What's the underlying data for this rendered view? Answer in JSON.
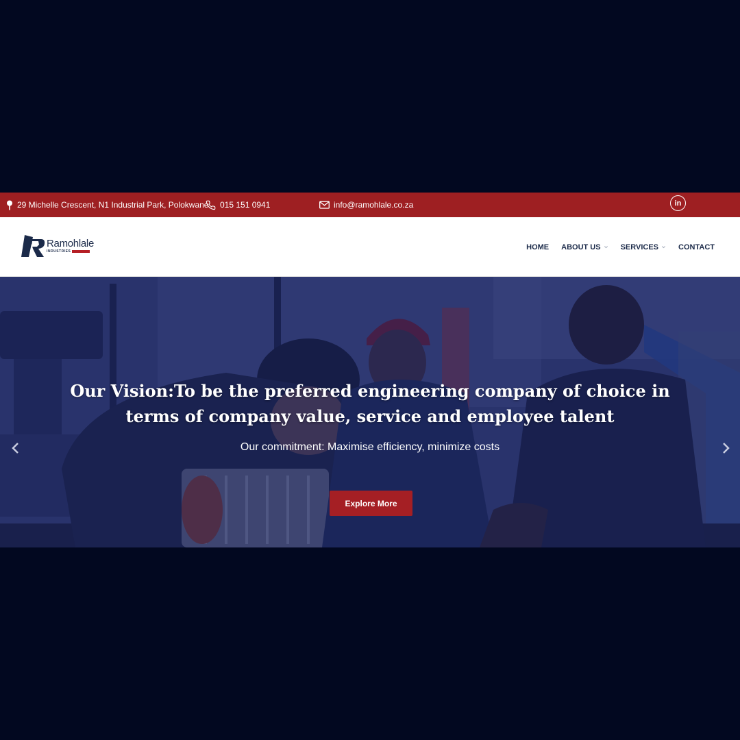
{
  "topbar": {
    "address": "29 Michelle Crescent, N1 Industrial Park, Polokwane",
    "phone": "015 151 0941",
    "email": "info@ramohlale.co.za",
    "social": "in"
  },
  "logo": {
    "name": "Ramohlale",
    "subtitle": "INDUSTRIES"
  },
  "nav": {
    "items": [
      {
        "label": "HOME",
        "dropdown": false
      },
      {
        "label": "ABOUT US",
        "dropdown": true
      },
      {
        "label": "SERVICES",
        "dropdown": true
      },
      {
        "label": "CONTACT",
        "dropdown": false
      }
    ]
  },
  "hero": {
    "title": "Our Vision:To be the preferred engineering company of choice in terms of company value, service and employee talent",
    "subtitle": "Our commitment: Maximise efficiency, minimize costs",
    "button": "Explore More"
  },
  "colors": {
    "brand_red": "#9e1f22",
    "navy": "#1b2a49",
    "background": "#020820"
  }
}
